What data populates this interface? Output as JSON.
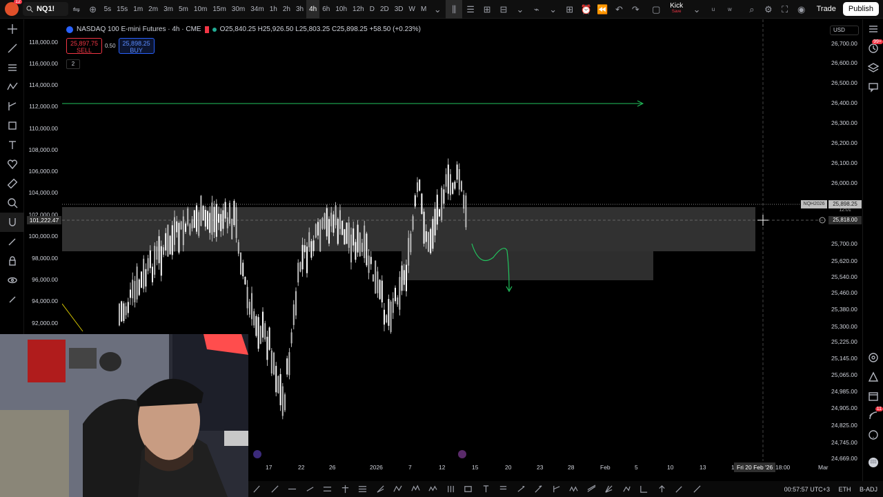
{
  "topbar": {
    "logo_badge": "12",
    "symbol": "NQ1!",
    "intervals": [
      "5s",
      "15s",
      "1m",
      "2m",
      "3m",
      "5m",
      "10m",
      "15m",
      "30m",
      "34m",
      "1h",
      "2h",
      "3h",
      "4h",
      "6h",
      "10h",
      "12h",
      "D",
      "2D",
      "3D",
      "W",
      "M"
    ],
    "active_interval": "4h",
    "kick_label": "Kick",
    "kick_sub": "Save",
    "user_u": "u",
    "user_w": "w",
    "trade_label": "Trade",
    "publish_label": "Publish"
  },
  "legend": {
    "title": "NASDAQ 100 E-mini Futures · 4h · CME",
    "ohlc": "O25,840.25 H25,926.50 L25,803.25 C25,898.25 +58.50 (+0.23%)",
    "sell_price": "25,897.75",
    "sell_label": "SELL",
    "spread": "0.50",
    "buy_price": "25,898.25",
    "buy_label": "BUY",
    "layer_count": "2"
  },
  "left_axis": {
    "labels": [
      "118,000.00",
      "116,000.00",
      "114,000.00",
      "112,000.00",
      "110,000.00",
      "108,000.00",
      "106,000.00",
      "104,000.00",
      "102,000.00",
      "100,000.00",
      "98,000.00",
      "96,000.00",
      "94,000.00",
      "92,000.00"
    ],
    "highlight": "101,222.47"
  },
  "right_axis": {
    "currency": "USD",
    "labels": [
      "26,700.00",
      "26,600.00",
      "26,500.00",
      "26,400.00",
      "26,300.00",
      "26,200.00",
      "26,100.00",
      "26,000.00",
      "25,700.00",
      "25,620.00",
      "25,540.00",
      "25,460.00",
      "25,380.00",
      "25,300.00",
      "25,225.00",
      "25,145.00",
      "25,065.00",
      "24,985.00",
      "24,905.00",
      "24,825.00",
      "24,745.00",
      "24,669.00"
    ],
    "symbol_tag": "NQH2026",
    "last_price": "25,898.25",
    "countdown": "12:01",
    "crosshair_price": "25,818.00"
  },
  "time_axis": {
    "labels": [
      "17",
      "22",
      "26",
      "2026",
      "7",
      "12",
      "15",
      "20",
      "23",
      "28",
      "Feb",
      "5",
      "10",
      "13",
      "1",
      "Mar"
    ],
    "crosshair_date": "Fri 20 Feb '26",
    "crosshair_time": "18:00"
  },
  "status": {
    "clock": "00:57:57 UTC+3",
    "currency": "ETH",
    "adjust": "B-ADJ"
  },
  "right_tools": {
    "notif_badge": "99+",
    "alert_badge": "11"
  },
  "colors": {
    "bull": "#22ab94",
    "bear": "#f23645",
    "line_green": "#22c55e",
    "zone": "#3a3a3a"
  }
}
